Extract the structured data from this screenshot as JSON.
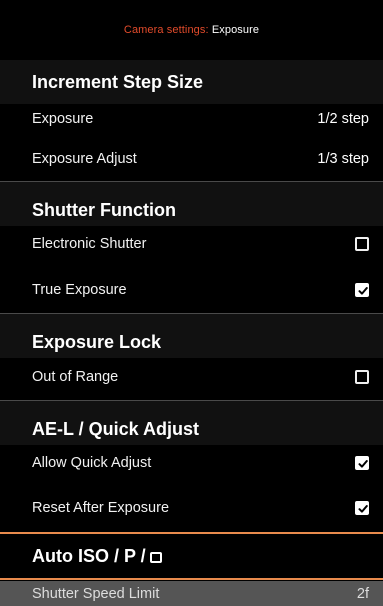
{
  "title": {
    "prefix": "Camera settings:",
    "current": "Exposure",
    "prefix_color": "#e24b2b"
  },
  "sections": {
    "increment": {
      "header": "Increment Step Size",
      "rows": [
        {
          "label": "Exposure",
          "value": "1/2 step"
        },
        {
          "label": "Exposure Adjust",
          "value": "1/3 step"
        }
      ]
    },
    "shutter": {
      "header": "Shutter Function",
      "rows": [
        {
          "label": "Electronic Shutter",
          "checked": false
        },
        {
          "label": "True Exposure",
          "checked": true
        }
      ]
    },
    "lock": {
      "header": "Exposure Lock",
      "rows": [
        {
          "label": "Out of Range",
          "checked": false
        }
      ]
    },
    "ael": {
      "header": "AE-L / Quick Adjust",
      "rows": [
        {
          "label": "Allow Quick Adjust",
          "checked": true
        },
        {
          "label": "Reset After Exposure",
          "checked": true
        }
      ]
    },
    "autoiso": {
      "header": "Auto ISO / P /",
      "icon": "square-mode-icon"
    }
  },
  "bottom_row": {
    "label": "Shutter Speed Limit",
    "value": "2f"
  },
  "colors": {
    "accent_line": "#e88b4d",
    "background": "#000000",
    "section_bg": "#111111",
    "bottom_bg": "#555555"
  }
}
